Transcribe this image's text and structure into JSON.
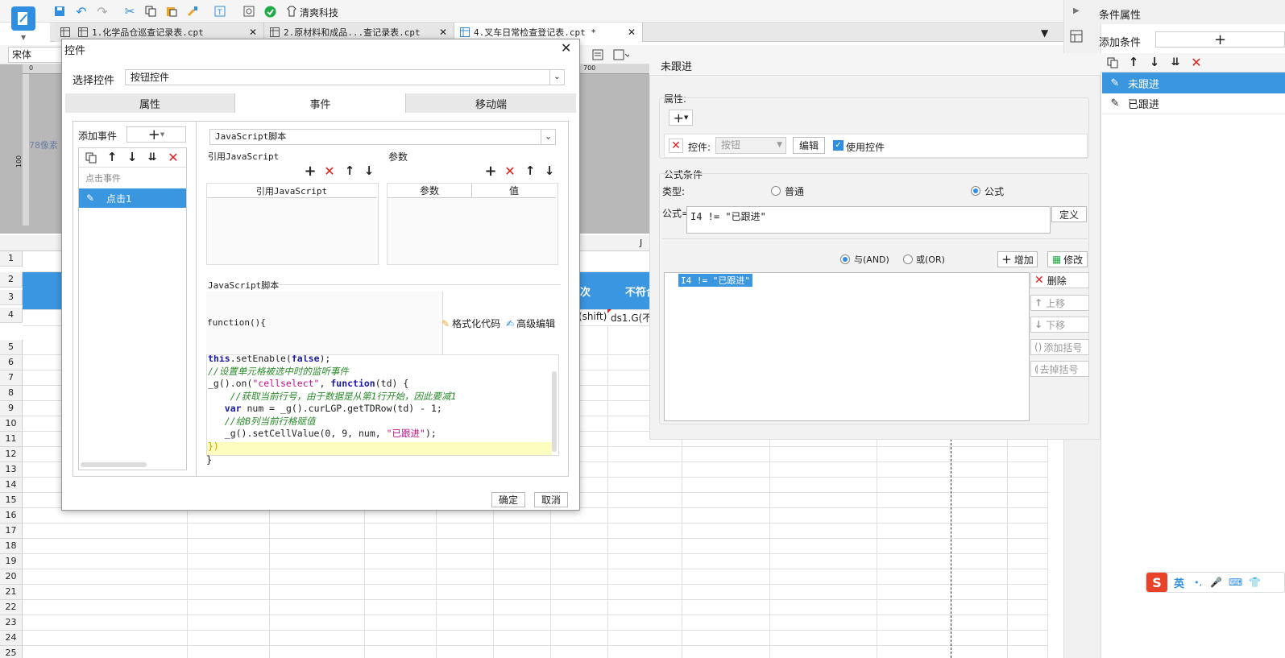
{
  "toolbar": {
    "company": "清爽科技"
  },
  "tabs": [
    {
      "label": "1.化学品仓巡查记录表.cpt"
    },
    {
      "label": "2.原材料和成品...查记录表.cpt"
    },
    {
      "label": "4.叉车日常检查登记表.cpt *"
    }
  ],
  "font_select": {
    "value": "宋体"
  },
  "ruler": {
    "mark0": "0",
    "mark700": "700",
    "px_label": "78像素",
    "mark100": "100"
  },
  "sheet": {
    "rows": [
      "1",
      "2",
      "3",
      "4",
      "5",
      "6",
      "7",
      "8",
      "9",
      "10",
      "11",
      "12",
      "13",
      "14",
      "15",
      "16",
      "17",
      "18",
      "19",
      "20",
      "21",
      "22",
      "23",
      "24",
      "25"
    ],
    "col_j": "J",
    "cell_ci": "次",
    "cell_bufu": "不符合",
    "cell_shift": "(shift)",
    "cell_ds": "ds1.G(不"
  },
  "dialog": {
    "title": "控件",
    "select_label": "选择控件",
    "select_value": "按钮控件",
    "tabs": [
      "属性",
      "事件",
      "移动端"
    ],
    "add_event": "添加事件",
    "event_group": "点击事件",
    "event_item": "点击1",
    "script_type": "JavaScript脚本",
    "ref_js_title": "引用JavaScript",
    "ref_js_col": "引用JavaScript",
    "param_title": "参数",
    "param_col": "参数",
    "value_col": "值",
    "script_section": "JavaScript脚本",
    "function_head": "function(){",
    "format_code": "格式化代码",
    "advanced_edit": "高级编辑",
    "code_lines": [
      "this.setEnable(false);",
      "//设置单元格被选中时的监听事件",
      "_g().on(\"cellselect\", function(td) {",
      "    //获取当前行号，由于数据是从第1行开始，因此要减1",
      "   var num = _g().curLGP.getTDRow(td) - 1;",
      "   //给B列当前行格赋值",
      "   _g().setCellValue(0, 9, num, \"已跟进\");",
      "})"
    ],
    "closing": "}",
    "ok": "确定",
    "cancel": "取消"
  },
  "cond_panel": {
    "title": "未跟进",
    "attr_label": "属性:",
    "control_label": "控件:",
    "control_value": "按钮",
    "edit_btn": "编辑",
    "use_control": "使用控件",
    "formula_cond": "公式条件",
    "type_label": "类型:",
    "radio_normal": "普通",
    "radio_formula": "公式",
    "formula_label": "公式=",
    "formula_value": "I4 != \"已跟进\"",
    "define_btn": "定义",
    "and_label": "与(AND)",
    "or_label": "或(OR)",
    "add_btn": "增加",
    "modify_btn": "修改",
    "delete_btn": "删除",
    "up_btn": "上移",
    "down_btn": "下移",
    "add_bracket": "添加括号",
    "remove_bracket": "去掉括号",
    "list_item": "I4 != \"已跟进\""
  },
  "right_panel": {
    "title": "条件属性",
    "add_cond": "添加条件",
    "items": [
      "未跟进",
      "已跟进"
    ]
  },
  "ime": {
    "lang": "英",
    "punct": "•,"
  },
  "colors": {
    "accent": "#3b96e0",
    "red": "#e02020",
    "selected": "#3b96e0"
  }
}
